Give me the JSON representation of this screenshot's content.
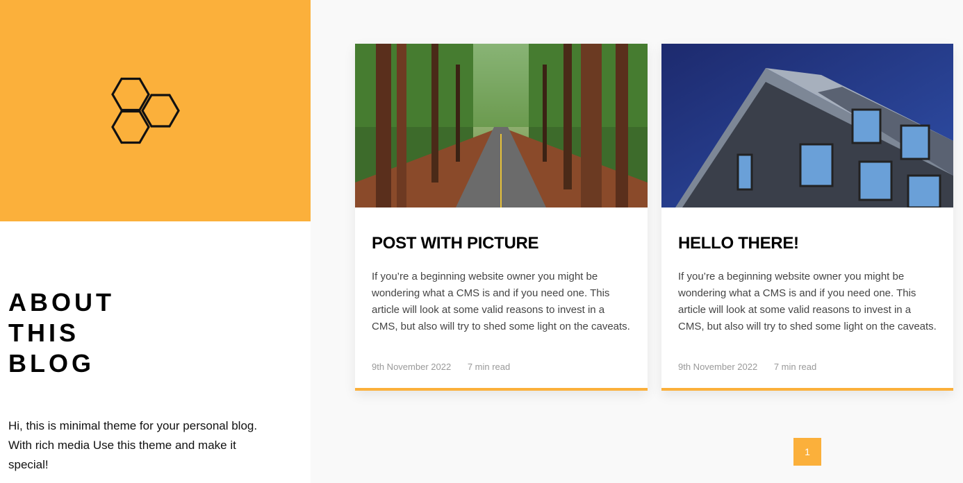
{
  "sidebar": {
    "about_lines": [
      "ABOUT",
      "THIS",
      "BLOG"
    ],
    "description": "Hi, this is minimal theme for your personal blog. With rich media Use this theme and make it special!"
  },
  "posts": [
    {
      "title": "POST WITH PICTURE",
      "excerpt": "If you’re a beginning website owner you might be wondering what a CMS is and if you need one. This article will look at some valid reasons to invest in a CMS, but also will try to shed some light on the caveats.",
      "date": "9th November 2022",
      "read_time": "7 min read",
      "image": "forest-road"
    },
    {
      "title": "HELLO THERE!",
      "excerpt": "If you’re a beginning website owner you might be wondering what a CMS is and if you need one. This article will look at some valid reasons to invest in a CMS, but also will try to shed some light on the caveats.",
      "date": "9th November 2022",
      "read_time": "7 min read",
      "image": "modern-building"
    }
  ],
  "pagination": {
    "current": "1"
  },
  "colors": {
    "accent": "#fbb03b",
    "sidebar_bg": "#ffffff",
    "main_bg": "#f9f9f9"
  }
}
